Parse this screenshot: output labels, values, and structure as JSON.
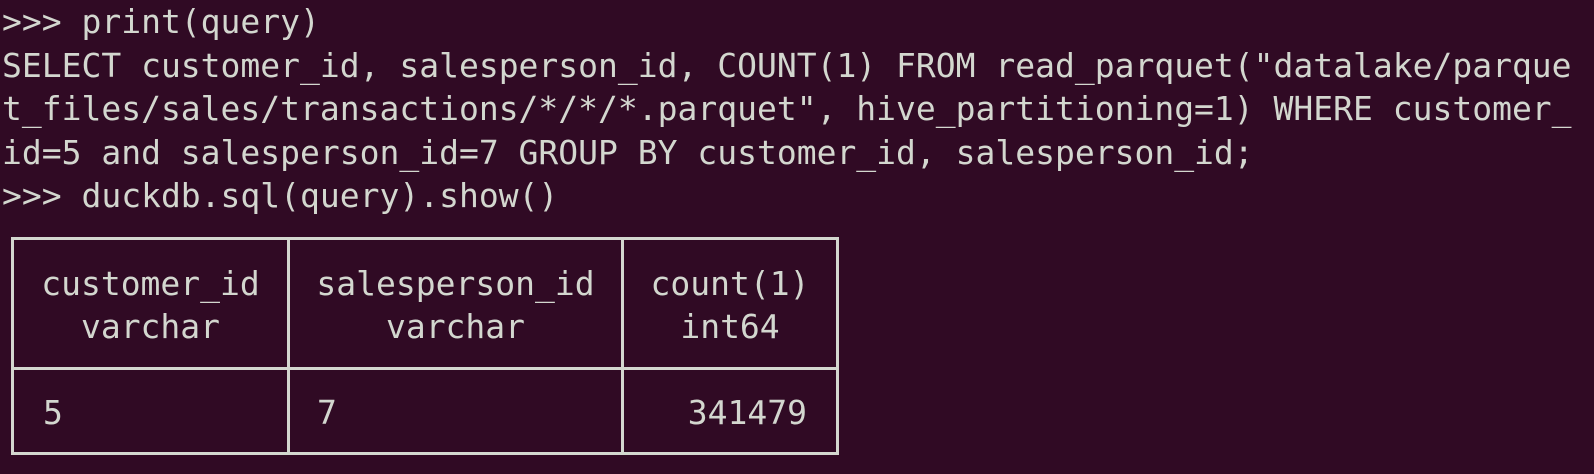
{
  "terminal": {
    "lines": [
      ">>> print(query)",
      "SELECT customer_id, salesperson_id, COUNT(1) FROM read_parquet(\"datalake/parque",
      "t_files/sales/transactions/*/*/*.parquet\", hive_partitioning=1) WHERE customer_",
      "id=5 and salesperson_id=7 GROUP BY customer_id, salesperson_id;",
      ">>> duckdb.sql(query).show()"
    ]
  },
  "result": {
    "columns": [
      {
        "name": "customer_id",
        "type": "varchar"
      },
      {
        "name": "salesperson_id",
        "type": "varchar"
      },
      {
        "name": "count(1)",
        "type": "int64"
      }
    ],
    "rows": [
      [
        "5",
        "7",
        "341479"
      ]
    ]
  },
  "colors": {
    "background": "#300a24",
    "foreground": "#d3d7cf"
  }
}
